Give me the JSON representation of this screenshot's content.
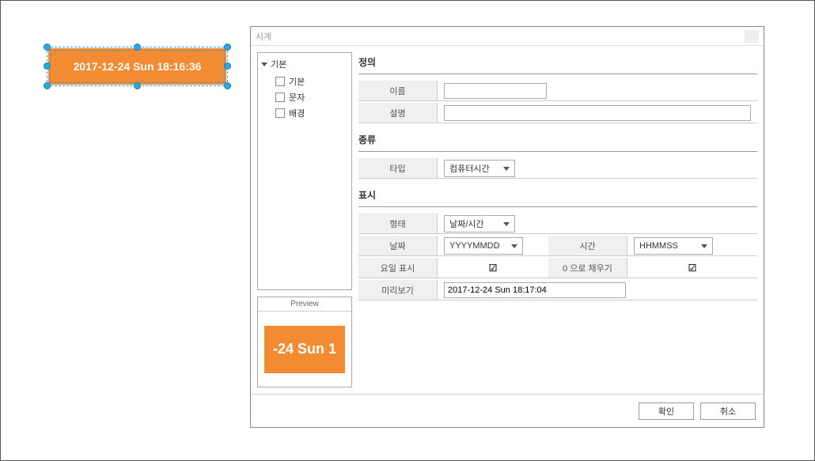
{
  "canvas": {
    "widget_text": "2017-12-24 Sun 18:16:36"
  },
  "dialog": {
    "title": "시계",
    "tree": {
      "root": "기본",
      "items": [
        "기본",
        "문자",
        "배경"
      ]
    },
    "preview": {
      "label": "Preview",
      "sample_text": "-24 Sun 1"
    },
    "sections": {
      "definition": {
        "title": "정의",
        "name_label": "이름",
        "name_value": "",
        "desc_label": "설명",
        "desc_value": ""
      },
      "type": {
        "title": "종류",
        "type_label": "타입",
        "type_value": "컴퓨터시간"
      },
      "display": {
        "title": "표시",
        "form_label": "형태",
        "form_value": "날짜/시간",
        "date_label": "날짜",
        "date_value": "YYYYMMDD",
        "time_label": "시간",
        "time_value": "HHMMSS",
        "weekday_label": "요일 표시",
        "weekday_checked": true,
        "zeropad_label": "0 으로 채우기",
        "zeropad_checked": true,
        "preview_label": "미리보기",
        "preview_value": "2017-12-24 Sun 18:17:04"
      }
    },
    "buttons": {
      "ok": "확인",
      "cancel": "취소"
    }
  }
}
